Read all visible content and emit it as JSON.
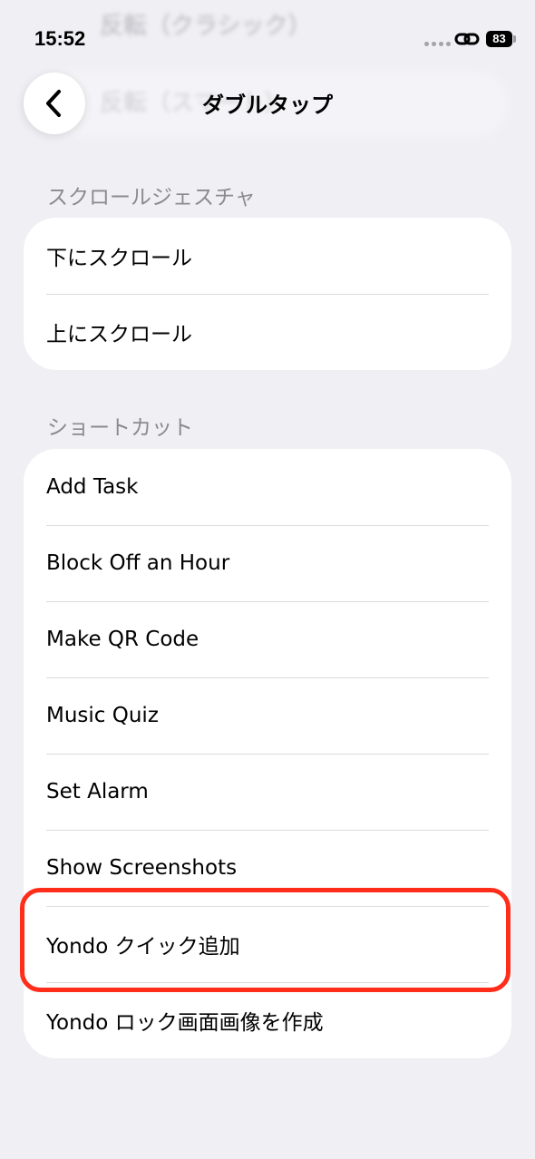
{
  "status_bar": {
    "time": "15:52",
    "battery": "83",
    "icons": [
      "cellular-dots-icon",
      "personal-hotspot-link-icon",
      "battery-icon"
    ]
  },
  "background_ghost": {
    "line1": "反転（クラシック）",
    "line2": "反転（スマート）"
  },
  "nav": {
    "title": "ダブルタップ",
    "back_icon": "chevron-left-icon"
  },
  "sections": {
    "scroll": {
      "header": "スクロールジェスチャ",
      "items": [
        "下にスクロール",
        "上にスクロール"
      ]
    },
    "shortcuts": {
      "header": "ショートカット",
      "items": [
        "Add Task",
        "Block Off an Hour",
        "Make QR Code",
        "Music Quiz",
        "Set Alarm",
        "Show Screenshots",
        "Yondo クイック追加",
        "Yondo ロック画面画像を作成"
      ]
    }
  },
  "colors": {
    "background": "#efeff4",
    "highlight": "#ff2d1a",
    "section_header": "#8a8a8f"
  }
}
